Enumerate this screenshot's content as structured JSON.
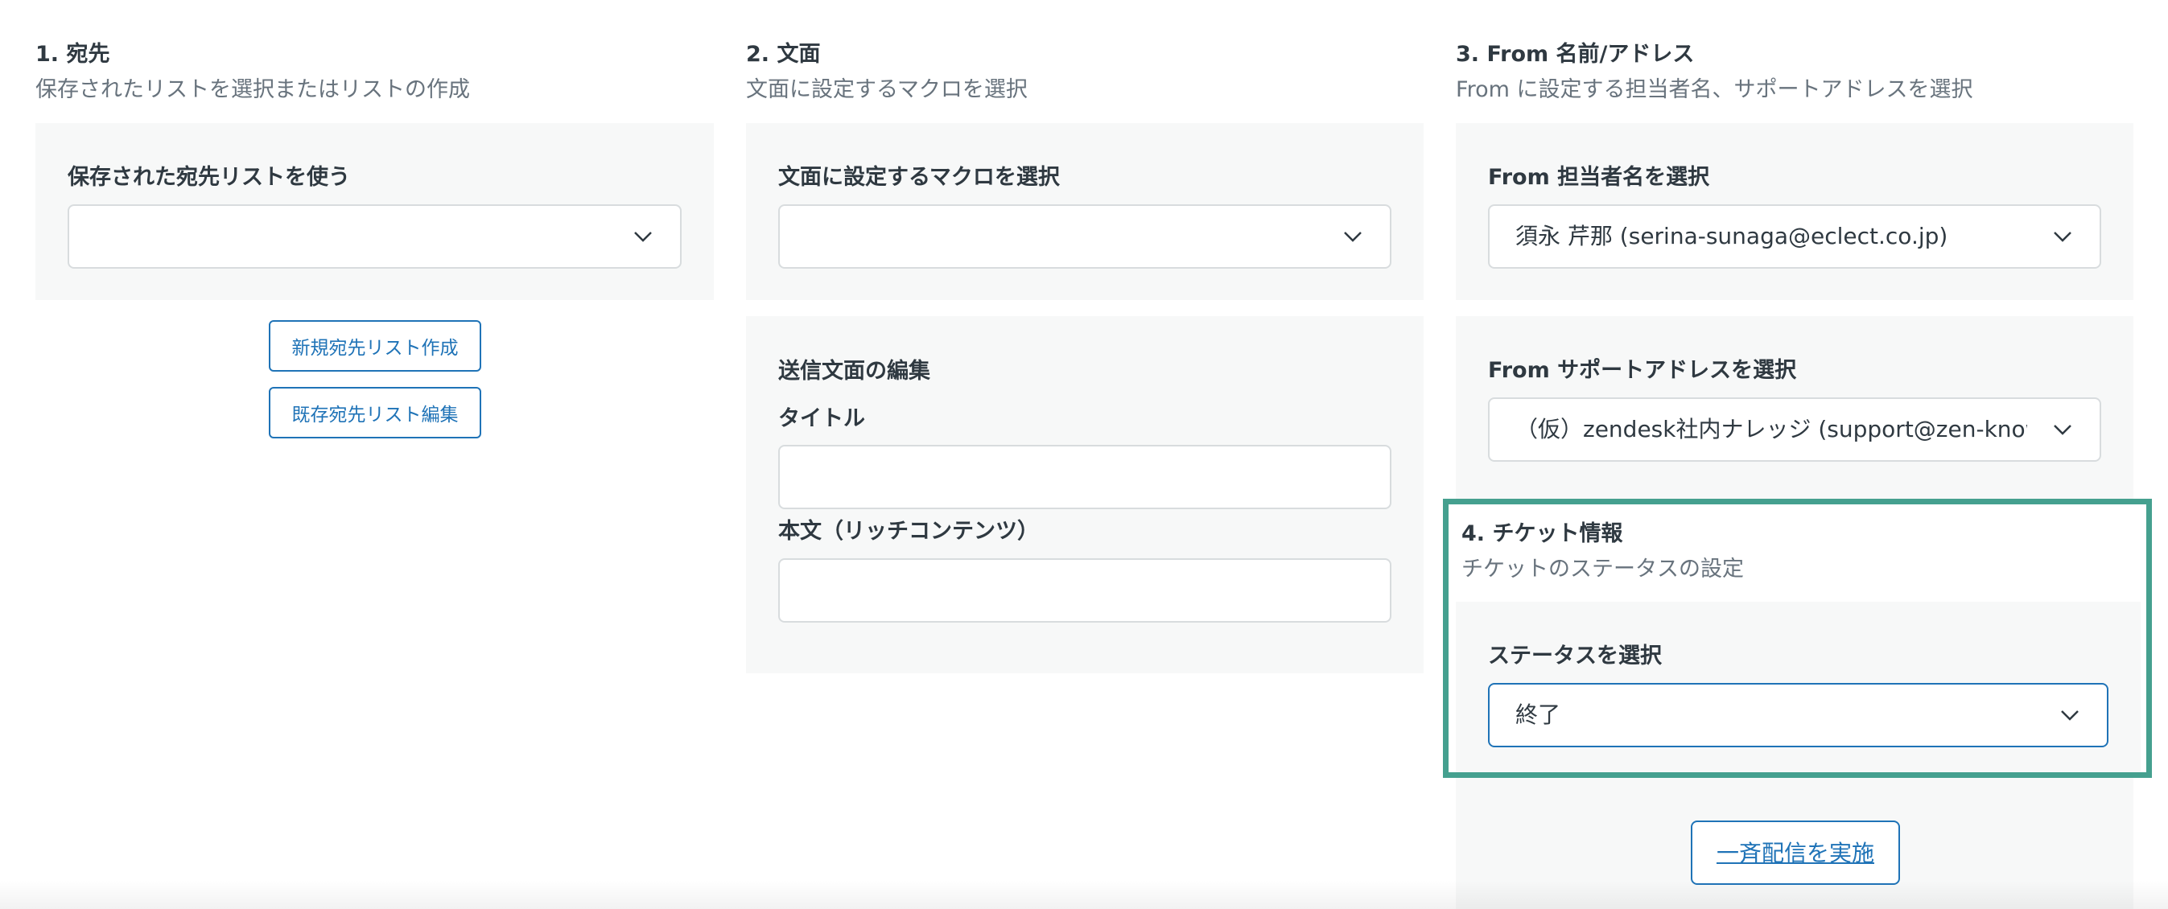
{
  "recipients": {
    "title": "1. 宛先",
    "description": "保存されたリストを選択またはリストの作成",
    "saved_list_label": "保存された宛先リストを使う",
    "saved_list_value": "",
    "new_list_button": "新規宛先リスト作成",
    "edit_list_button": "既存宛先リスト編集"
  },
  "message": {
    "title": "2. 文面",
    "description": "文面に設定するマクロを選択",
    "macro_label": "文面に設定するマクロを選択",
    "macro_value": "",
    "edit_heading": "送信文面の編集",
    "title_label": "タイトル",
    "title_value": "",
    "body_label": "本文（リッチコンテンツ）",
    "body_value": ""
  },
  "from": {
    "title": "3. From 名前/アドレス",
    "description": "From に設定する担当者名、サポートアドレスを選択",
    "agent_label": "From 担当者名を選択",
    "agent_value": "須永 芹那 (serina-sunaga@eclect.co.jp)",
    "support_label": "From サポートアドレスを選択",
    "support_value": "（仮）zendesk社内ナレッジ (support@zen-knowledge"
  },
  "ticket": {
    "title": "4. チケット情報",
    "description": "チケットのステータスの設定",
    "status_label": "ステータスを選択",
    "status_value": "終了"
  },
  "actions": {
    "bulk_send_button": "一斉配信を実施"
  },
  "colors": {
    "accent": "#1f73b7",
    "highlight": "#45a08f",
    "panel": "#f7f8f8"
  }
}
